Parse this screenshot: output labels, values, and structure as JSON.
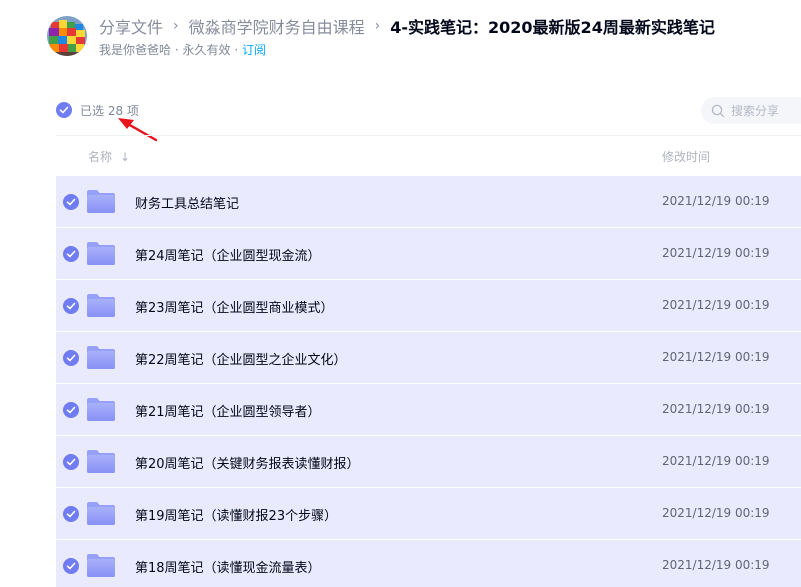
{
  "header": {
    "breadcrumb": {
      "root": "分享文件",
      "parent": "微淼商学院财务自由课程",
      "current": "4-实践笔记：2020最新版24周最新实践笔记"
    },
    "sharer": "我是你爸爸哈",
    "validity": "永久有效",
    "subscribe": "订阅"
  },
  "selection": {
    "label": "已选 28 项"
  },
  "search": {
    "placeholder": "搜索分享"
  },
  "columns": {
    "name": "名称",
    "modified": "修改时间"
  },
  "files": [
    {
      "name": "财务工具总结笔记",
      "modified": "2021/12/19 00:19"
    },
    {
      "name": "第24周笔记（企业圆型现金流）",
      "modified": "2021/12/19 00:19"
    },
    {
      "name": "第23周笔记（企业圆型商业模式）",
      "modified": "2021/12/19 00:19"
    },
    {
      "name": "第22周笔记（企业圆型之企业文化）",
      "modified": "2021/12/19 00:19"
    },
    {
      "name": "第21周笔记（企业圆型领导者）",
      "modified": "2021/12/19 00:19"
    },
    {
      "name": "第20周笔记（关键财务报表读懂财报）",
      "modified": "2021/12/19 00:19"
    },
    {
      "name": "第19周笔记（读懂财报23个步骤）",
      "modified": "2021/12/19 00:19"
    },
    {
      "name": "第18周笔记（读懂现金流量表）",
      "modified": "2021/12/19 00:19"
    }
  ],
  "icons": {
    "avatar": "avatar",
    "selected": "check-circle-icon",
    "search": "search-icon",
    "folder": "folder-icon",
    "sort": "sort-down-icon",
    "annotation": "red-arrow-annotation"
  },
  "colors": {
    "accent": "#6f7cf2",
    "selected_row": "#e9eafd",
    "link": "#06a7ff",
    "arrow": "#e8131b"
  }
}
